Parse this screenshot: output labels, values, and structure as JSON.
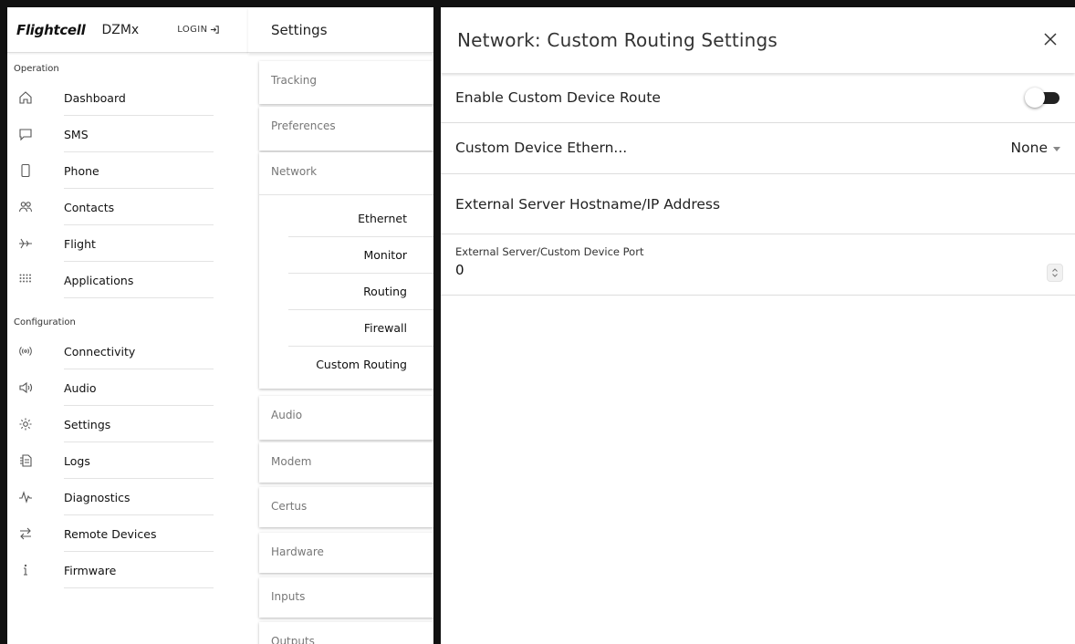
{
  "nav": {
    "logo": "Flightcell",
    "device": "DZMx",
    "login_label": "LOGIN",
    "sections": [
      {
        "title": "Operation",
        "items": [
          {
            "label": "Dashboard",
            "icon": "home-icon"
          },
          {
            "label": "SMS",
            "icon": "message-icon"
          },
          {
            "label": "Phone",
            "icon": "phone-icon"
          },
          {
            "label": "Contacts",
            "icon": "contacts-icon"
          },
          {
            "label": "Flight",
            "icon": "plane-icon"
          },
          {
            "label": "Applications",
            "icon": "apps-grid-icon"
          }
        ]
      },
      {
        "title": "Configuration",
        "items": [
          {
            "label": "Connectivity",
            "icon": "wireless-icon"
          },
          {
            "label": "Audio",
            "icon": "speaker-icon"
          },
          {
            "label": "Settings",
            "icon": "gear-icon"
          },
          {
            "label": "Logs",
            "icon": "logs-icon"
          },
          {
            "label": "Diagnostics",
            "icon": "pulse-icon"
          },
          {
            "label": "Remote Devices",
            "icon": "swap-arrows-icon"
          },
          {
            "label": "Firmware",
            "icon": "info-icon"
          }
        ]
      }
    ]
  },
  "settings": {
    "title": "Settings",
    "cards": [
      "Tracking",
      "Preferences",
      "Network",
      "Audio",
      "Modem",
      "Certus",
      "Hardware",
      "Inputs",
      "Outputs"
    ],
    "network_children": [
      "Ethernet",
      "Monitor",
      "Routing",
      "Firewall",
      "Custom Routing"
    ]
  },
  "panel": {
    "title": "Network: Custom Routing Settings",
    "close_icon": "close-icon",
    "enable_label": "Enable Custom Device Route",
    "enable_on": false,
    "ethernet_label": "Custom Device Ethern...",
    "ethernet_value": "None",
    "hostname_label": "External Server Hostname/IP Address",
    "port_label": "External Server/Custom Device Port",
    "port_value": "0"
  }
}
